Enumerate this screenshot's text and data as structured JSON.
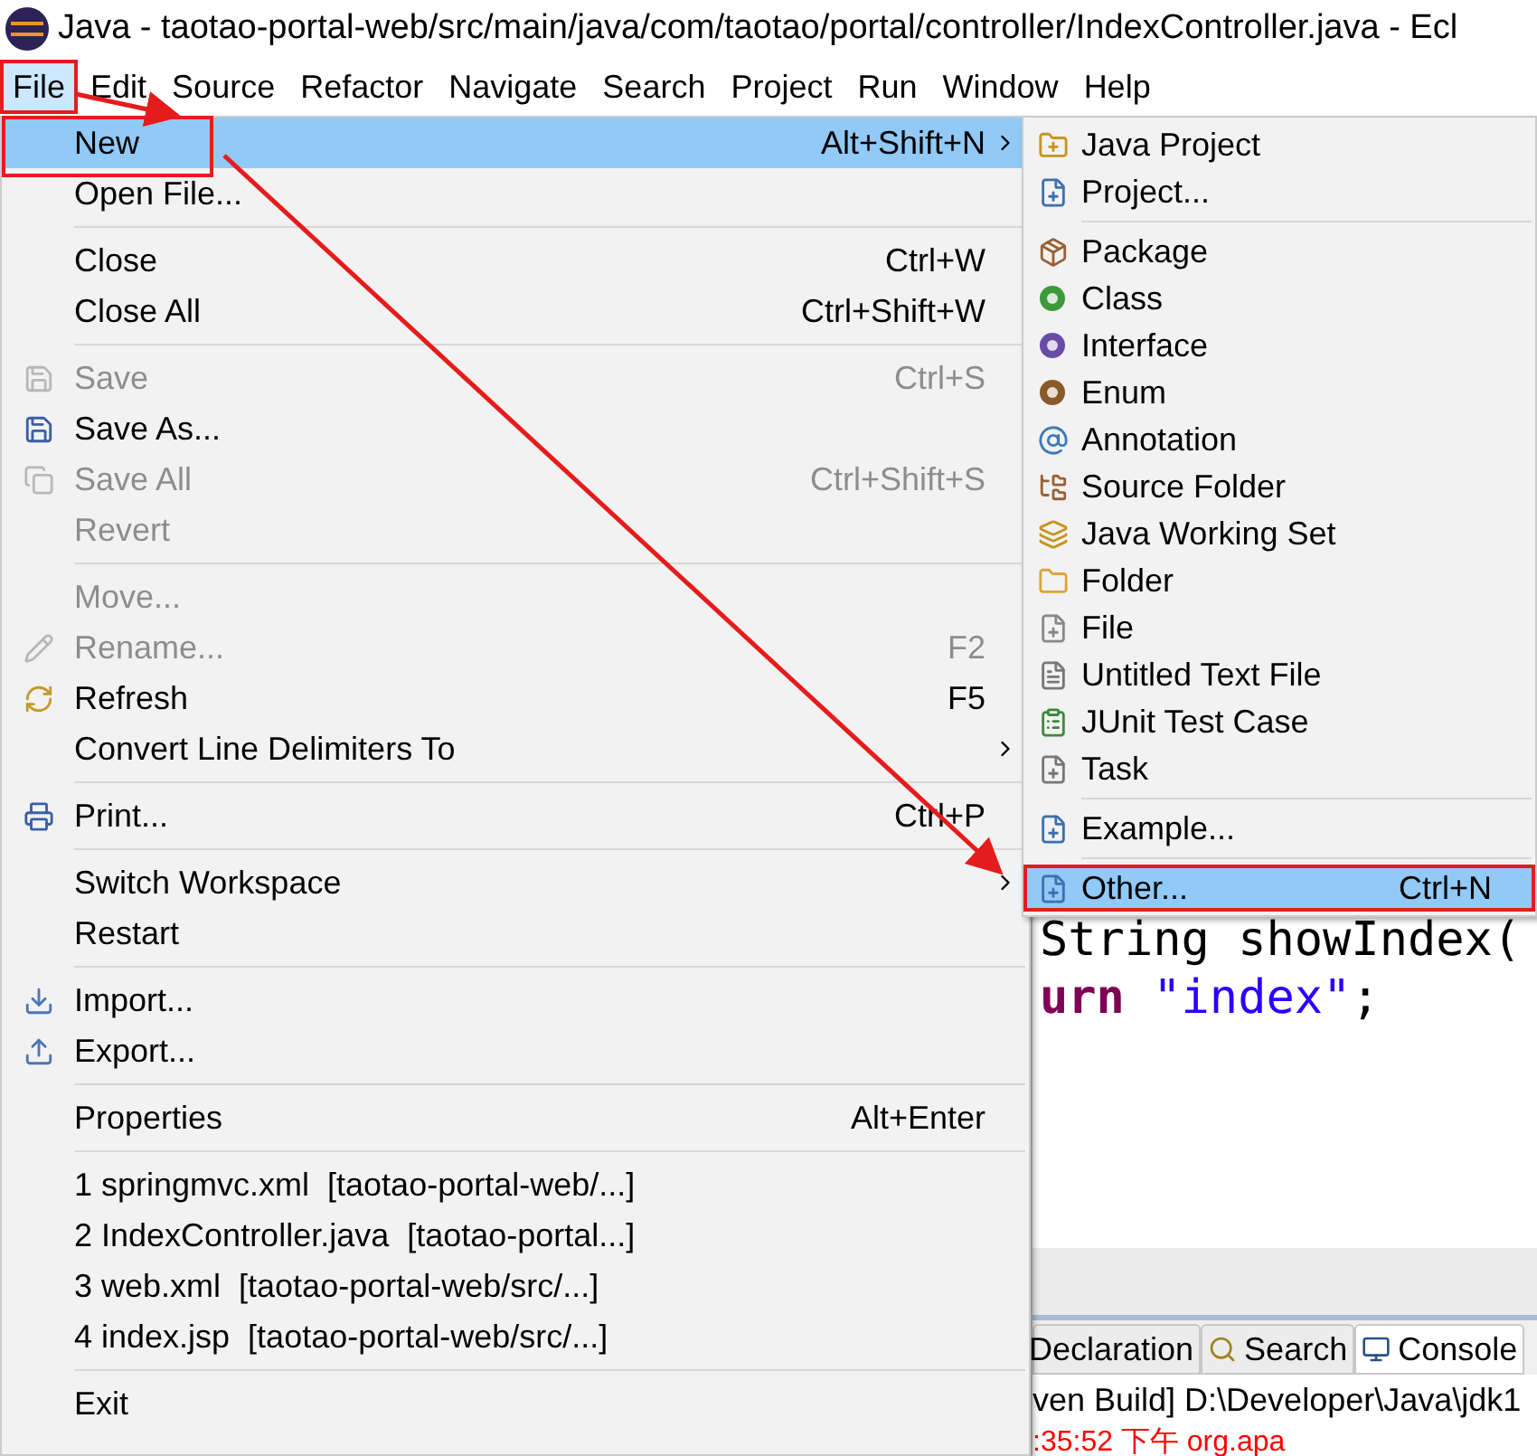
{
  "window": {
    "title": "Java - taotao-portal-web/src/main/java/com/taotao/portal/controller/IndexController.java - Ecl"
  },
  "menubar": [
    {
      "label": "File",
      "selected": true,
      "annotated": true
    },
    {
      "label": "Edit",
      "selected": false,
      "annotated": false
    },
    {
      "label": "Source",
      "selected": false,
      "annotated": false
    },
    {
      "label": "Refactor",
      "selected": false,
      "annotated": false
    },
    {
      "label": "Navigate",
      "selected": false,
      "annotated": false
    },
    {
      "label": "Search",
      "selected": false,
      "annotated": false
    },
    {
      "label": "Project",
      "selected": false,
      "annotated": false
    },
    {
      "label": "Run",
      "selected": false,
      "annotated": false
    },
    {
      "label": "Window",
      "selected": false,
      "annotated": false
    },
    {
      "label": "Help",
      "selected": false,
      "annotated": false
    }
  ],
  "file_menu": [
    {
      "kind": "item",
      "label": "New",
      "shortcut": "Alt+Shift+N",
      "submenu": true,
      "disabled": false,
      "selected": true,
      "annotated": true
    },
    {
      "kind": "item",
      "label": "Open File...",
      "disabled": false,
      "selected": false,
      "annotated": false,
      "submenu": false
    },
    {
      "kind": "separator"
    },
    {
      "kind": "item",
      "label": "Close",
      "shortcut": "Ctrl+W",
      "disabled": false,
      "selected": false,
      "annotated": false,
      "submenu": false
    },
    {
      "kind": "item",
      "label": "Close All",
      "shortcut": "Ctrl+Shift+W",
      "disabled": false,
      "selected": false,
      "annotated": false,
      "submenu": false
    },
    {
      "kind": "separator"
    },
    {
      "kind": "item",
      "label": "Save",
      "shortcut": "Ctrl+S",
      "disabled": true,
      "selected": false,
      "annotated": false,
      "submenu": false
    },
    {
      "kind": "item",
      "label": "Save As...",
      "disabled": false,
      "selected": false,
      "annotated": false,
      "submenu": false
    },
    {
      "kind": "item",
      "label": "Save All",
      "shortcut": "Ctrl+Shift+S",
      "disabled": true,
      "selected": false,
      "annotated": false,
      "submenu": false
    },
    {
      "kind": "item",
      "label": "Revert",
      "disabled": true,
      "selected": false,
      "annotated": false,
      "submenu": false
    },
    {
      "kind": "separator"
    },
    {
      "kind": "item",
      "label": "Move...",
      "disabled": true,
      "selected": false,
      "annotated": false,
      "submenu": false
    },
    {
      "kind": "item",
      "label": "Rename...",
      "shortcut": "F2",
      "disabled": true,
      "selected": false,
      "annotated": false,
      "submenu": false
    },
    {
      "kind": "item",
      "label": "Refresh",
      "shortcut": "F5",
      "disabled": false,
      "selected": false,
      "annotated": false,
      "submenu": false
    },
    {
      "kind": "item",
      "label": "Convert Line Delimiters To",
      "submenu": true,
      "disabled": false,
      "selected": false,
      "annotated": false
    },
    {
      "kind": "separator"
    },
    {
      "kind": "item",
      "label": "Print...",
      "shortcut": "Ctrl+P",
      "disabled": false,
      "selected": false,
      "annotated": false,
      "submenu": false
    },
    {
      "kind": "separator"
    },
    {
      "kind": "item",
      "label": "Switch Workspace",
      "submenu": true,
      "disabled": false,
      "selected": false,
      "annotated": false
    },
    {
      "kind": "item",
      "label": "Restart",
      "disabled": false,
      "selected": false,
      "annotated": false,
      "submenu": false
    },
    {
      "kind": "separator"
    },
    {
      "kind": "item",
      "label": "Import...",
      "disabled": false,
      "selected": false,
      "annotated": false,
      "submenu": false
    },
    {
      "kind": "item",
      "label": "Export...",
      "disabled": false,
      "selected": false,
      "annotated": false,
      "submenu": false
    },
    {
      "kind": "separator"
    },
    {
      "kind": "item",
      "label": "Properties",
      "shortcut": "Alt+Enter",
      "disabled": false,
      "selected": false,
      "annotated": false,
      "submenu": false
    },
    {
      "kind": "separator"
    },
    {
      "kind": "item",
      "label": "1 springmvc.xml  [taotao-portal-web/...]",
      "disabled": false,
      "selected": false,
      "annotated": false,
      "submenu": false
    },
    {
      "kind": "item",
      "label": "2 IndexController.java  [taotao-portal...]",
      "disabled": false,
      "selected": false,
      "annotated": false,
      "submenu": false
    },
    {
      "kind": "item",
      "label": "3 web.xml  [taotao-portal-web/src/...]",
      "disabled": false,
      "selected": false,
      "annotated": false,
      "submenu": false
    },
    {
      "kind": "item",
      "label": "4 index.jsp  [taotao-portal-web/src/...]",
      "disabled": false,
      "selected": false,
      "annotated": false,
      "submenu": false
    },
    {
      "kind": "separator"
    },
    {
      "kind": "item",
      "label": "Exit",
      "disabled": false,
      "selected": false,
      "annotated": false,
      "submenu": false
    }
  ],
  "new_submenu": [
    {
      "kind": "item",
      "label": "Java Project",
      "selected": false,
      "annotated": false
    },
    {
      "kind": "item",
      "label": "Project...",
      "selected": false,
      "annotated": false
    },
    {
      "kind": "separator"
    },
    {
      "kind": "item",
      "label": "Package",
      "selected": false,
      "annotated": false
    },
    {
      "kind": "item",
      "label": "Class",
      "selected": false,
      "annotated": false
    },
    {
      "kind": "item",
      "label": "Interface",
      "selected": false,
      "annotated": false
    },
    {
      "kind": "item",
      "label": "Enum",
      "selected": false,
      "annotated": false
    },
    {
      "kind": "item",
      "label": "Annotation",
      "selected": false,
      "annotated": false
    },
    {
      "kind": "item",
      "label": "Source Folder",
      "selected": false,
      "annotated": false
    },
    {
      "kind": "item",
      "label": "Java Working Set",
      "selected": false,
      "annotated": false
    },
    {
      "kind": "item",
      "label": "Folder",
      "selected": false,
      "annotated": false
    },
    {
      "kind": "item",
      "label": "File",
      "selected": false,
      "annotated": false
    },
    {
      "kind": "item",
      "label": "Untitled Text File",
      "selected": false,
      "annotated": false
    },
    {
      "kind": "item",
      "label": "JUnit Test Case",
      "selected": false,
      "annotated": false
    },
    {
      "kind": "item",
      "label": "Task",
      "selected": false,
      "annotated": false
    },
    {
      "kind": "separator"
    },
    {
      "kind": "item",
      "label": "Example...",
      "selected": false,
      "annotated": false
    },
    {
      "kind": "separator"
    },
    {
      "kind": "item",
      "label": "Other...",
      "shortcut": "Ctrl+N",
      "selected": true,
      "annotated": true
    }
  ],
  "editor": {
    "lines": [
      [
        {
          "kind": "plain",
          "text": "String showIndex("
        }
      ],
      [
        {
          "kind": "keyword",
          "text": "urn"
        },
        {
          "kind": "string",
          "text": " \"index\""
        },
        {
          "kind": "plain",
          "text": ";"
        }
      ]
    ]
  },
  "bottom_panel": {
    "tabs": [
      {
        "label": "Declaration",
        "selected": false
      },
      {
        "label": "Search",
        "selected": false
      },
      {
        "label": "Console",
        "selected": true
      }
    ],
    "console_lines": [
      {
        "kind": "info",
        "text": "ven Build] D:\\Developer\\Java\\jdk1"
      },
      {
        "kind": "error",
        "text": ":35:52 下午 org.apa"
      }
    ]
  }
}
